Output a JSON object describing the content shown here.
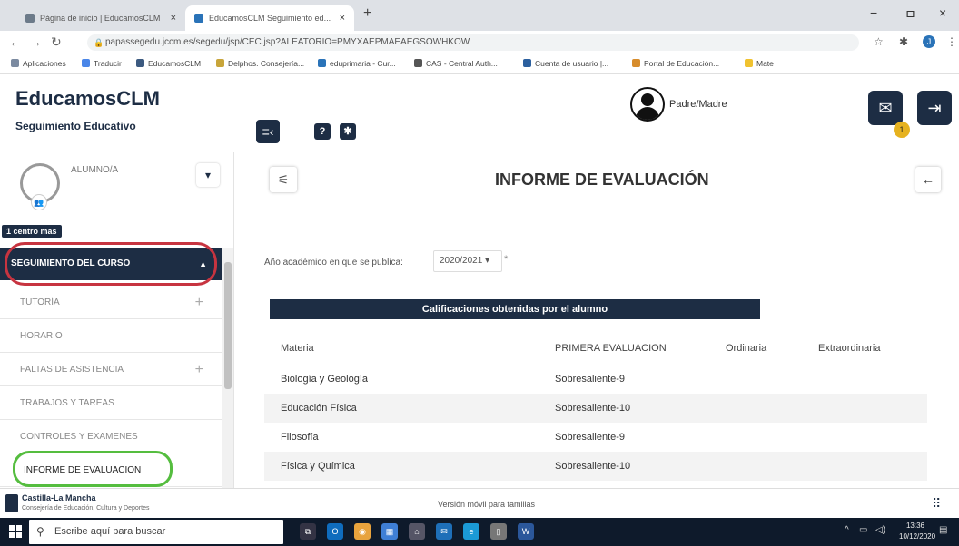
{
  "browser": {
    "tabs": [
      {
        "title": "Página de inicio | EducamosCLM"
      },
      {
        "title": "EducamosCLM Seguimiento ed..."
      }
    ],
    "new_tab": "+",
    "close_glyph": "×",
    "window_controls": [
      "−",
      "ㅁ",
      "×"
    ],
    "url": "papassegedu.jccm.es/segedu/jsp/CEC.jsp?ALEATORIO=PMYXAEPMAEAEGSOWHKOW",
    "bookmarks": [
      "Aplicaciones",
      "Traducir",
      "EducamosCLM",
      "Delphos. Consejería...",
      "eduprimaria - Cur...",
      "CAS - Central Auth...",
      "Cuenta de usuario |...",
      "Portal de Educación...",
      "Mate"
    ]
  },
  "header": {
    "brand": "EducamosCLM",
    "subtitle": "Seguimiento Educativo",
    "user_role": "Padre/Madre",
    "notification_count": "1"
  },
  "sidebar": {
    "student_label": "ALUMNO/A",
    "centros_badge": "1 centro mas",
    "active_section": "SEGUIMIENTO DEL CURSO",
    "items": [
      {
        "label": "TUTORÍA",
        "expandable": true
      },
      {
        "label": "HORARIO",
        "expandable": false
      },
      {
        "label": "FALTAS DE ASISTENCIA",
        "expandable": true
      },
      {
        "label": "TRABAJOS Y TAREAS",
        "expandable": false
      },
      {
        "label": "CONTROLES Y EXAMENES",
        "expandable": false
      },
      {
        "label": "INFORME DE EVALUACION",
        "expandable": false
      }
    ]
  },
  "main": {
    "title": "INFORME DE EVALUACIÓN",
    "year_label": "Año académico en que se publica:",
    "year_value": "2020/2021",
    "year_required": "*",
    "section_header": "Calificaciones obtenidas por el alumno",
    "table": {
      "columns": [
        "Materia",
        "PRIMERA EVALUACION",
        "Ordinaria",
        "Extraordinaria"
      ],
      "rows": [
        {
          "materia": "Biología y Geología",
          "primera": "Sobresaliente-9",
          "ordinaria": "",
          "extraordinaria": ""
        },
        {
          "materia": "Educación Física",
          "primera": "Sobresaliente-10",
          "ordinaria": "",
          "extraordinaria": ""
        },
        {
          "materia": "Filosofía",
          "primera": "Sobresaliente-9",
          "ordinaria": "",
          "extraordinaria": ""
        },
        {
          "materia": "Física y Química",
          "primera": "Sobresaliente-10",
          "ordinaria": "",
          "extraordinaria": ""
        }
      ]
    }
  },
  "footer": {
    "org_name": "Castilla-La Mancha",
    "org_sub": "Consejería de Educación, Cultura y Deportes",
    "mobile_version": "Versión móvil para familias"
  },
  "taskbar": {
    "search_placeholder": "Escribe aquí para buscar",
    "time": "13:36",
    "date": "10/12/2020"
  },
  "colors": {
    "navy": "#1d2d44",
    "highlight_red": "#c73440",
    "highlight_green": "#55bd3f",
    "badge_yellow": "#e6b220"
  }
}
